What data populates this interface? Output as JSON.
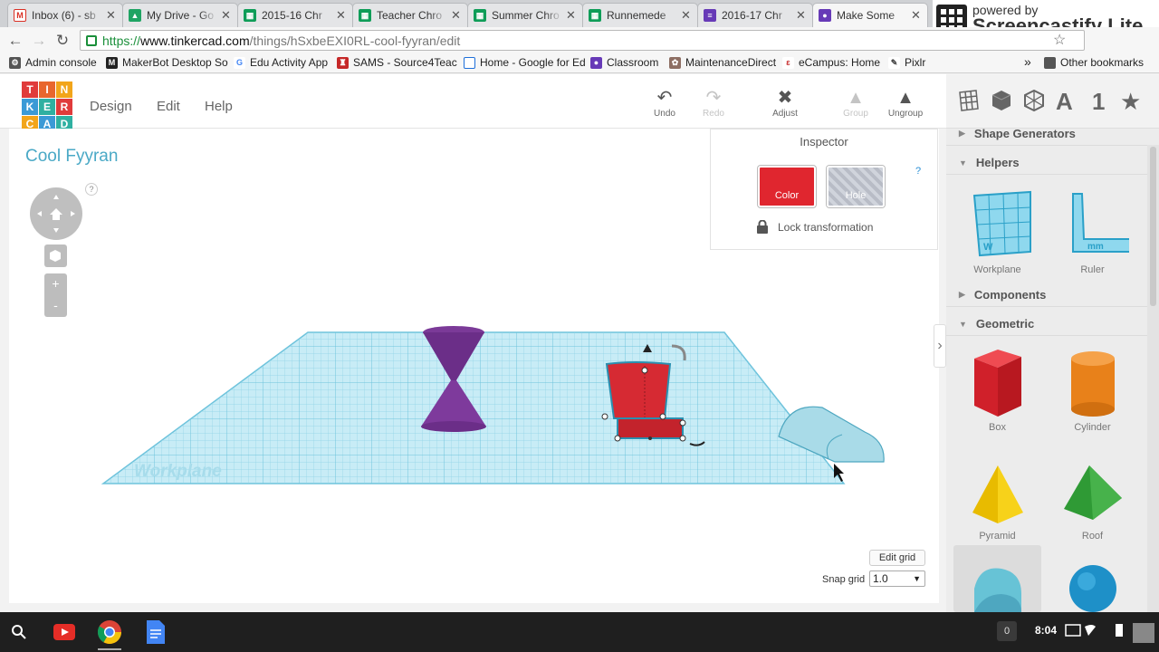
{
  "browser": {
    "tabs": [
      {
        "label": "Inbox (6) - sb",
        "icon": "gmail-icon",
        "color": "#d93025"
      },
      {
        "label": "My Drive - Go",
        "icon": "drive-icon",
        "color": "#1fa463"
      },
      {
        "label": "2015-16 Chr",
        "icon": "sheets-icon",
        "color": "#0f9d58"
      },
      {
        "label": "Teacher Chro",
        "icon": "sheets-icon",
        "color": "#0f9d58"
      },
      {
        "label": "Summer Chro",
        "icon": "sheets-icon",
        "color": "#0f9d58"
      },
      {
        "label": "Runnemede",
        "icon": "sheets-icon",
        "color": "#0f9d58"
      },
      {
        "label": "2016-17 Chr",
        "icon": "forms-icon",
        "color": "#673ab7"
      },
      {
        "label": "Make Some",
        "icon": "classroom-icon",
        "color": "#673ab7"
      }
    ],
    "url": {
      "protocol": "https://",
      "host": "www.tinkercad.com",
      "path": "/things/hSxbeEXI0RL-cool-fyyran/edit"
    },
    "bookmarks": [
      {
        "label": "Admin console",
        "icon": "admin-icon",
        "color": "#555555"
      },
      {
        "label": "MakerBot Desktop So",
        "icon": "makerbot-icon",
        "color": "#222222"
      },
      {
        "label": "Edu Activity App",
        "icon": "google-icon",
        "color": "#4285f4"
      },
      {
        "label": "SAMS - Source4Teac",
        "icon": "sams-icon",
        "color": "#c62828"
      },
      {
        "label": "Home - Google for Ed",
        "icon": "page-icon",
        "color": "#1e6fd9"
      },
      {
        "label": "Classroom",
        "icon": "classroom-icon",
        "color": "#673ab7"
      },
      {
        "label": "MaintenanceDirect",
        "icon": "maintenance-icon",
        "color": "#8d6e63"
      },
      {
        "label": "eCampus: Home",
        "icon": "ecampus-icon",
        "color": "#c62828"
      },
      {
        "label": "Pixlr",
        "icon": "pixlr-icon",
        "color": "#444444"
      }
    ],
    "bookmarks_overflow": "»",
    "other_bookmarks": "Other bookmarks"
  },
  "watermark": {
    "line1": "powered by",
    "line2": "Screencastify Lite"
  },
  "app": {
    "logo_letters": [
      "T",
      "I",
      "N",
      "K",
      "E",
      "R",
      "C",
      "A",
      "D"
    ],
    "logo_colors": [
      "#e03b3b",
      "#e8662d",
      "#f2a51a",
      "#3b9ad6",
      "#2fb0a1",
      "#e03b3b",
      "#f2a51a",
      "#3b9ad6",
      "#2fb0a1"
    ],
    "menu": [
      "Design",
      "Edit",
      "Help"
    ],
    "tools": {
      "undo": "Undo",
      "redo": "Redo",
      "adjust": "Adjust",
      "group": "Group",
      "ungroup": "Ungroup"
    },
    "project_title": "Cool Fyyran",
    "help_mark": "?",
    "zoom_in": "+",
    "zoom_out": "-"
  },
  "inspector": {
    "title": "Inspector",
    "color_label": "Color",
    "hole_label": "Hole",
    "help": "?",
    "lock_label": "Lock transformation",
    "color_value": "#e0262f"
  },
  "workplane": {
    "label": "Workplane"
  },
  "grid": {
    "edit_label": "Edit grid",
    "snap_label": "Snap grid",
    "snap_value": "1.0"
  },
  "sidebar": {
    "top_icons": [
      "grid-icon",
      "cube-icon",
      "sphere-icon",
      "letter-a-icon",
      "number-one-icon",
      "star-icon"
    ],
    "letter": "A",
    "number": "1",
    "sections": {
      "shape_generators": "Shape Generators",
      "helpers": "Helpers",
      "components": "Components",
      "geometric": "Geometric"
    },
    "helpers": [
      {
        "label": "Workplane",
        "icon": "workplane-shape-icon"
      },
      {
        "label": "Ruler",
        "icon": "ruler-shape-icon"
      }
    ],
    "geometric": [
      {
        "label": "Box",
        "icon": "box-shape-icon",
        "color": "#e0262f"
      },
      {
        "label": "Cylinder",
        "icon": "cylinder-shape-icon",
        "color": "#e8811a"
      },
      {
        "label": "Pyramid",
        "icon": "pyramid-shape-icon",
        "color": "#f2c500"
      },
      {
        "label": "Roof",
        "icon": "roof-shape-icon",
        "color": "#37a33b"
      },
      {
        "label": "",
        "icon": "half-cylinder-shape-icon",
        "color": "#67c3d6"
      },
      {
        "label": "",
        "icon": "sphere-shape-icon",
        "color": "#1e90c8"
      }
    ],
    "ruler_mark": "mm",
    "workplane_mark": "W"
  },
  "taskbar": {
    "apps": [
      "launcher-search-icon",
      "youtube-icon",
      "chrome-icon",
      "docs-icon"
    ],
    "notification_count": "0",
    "time": "8:04"
  }
}
